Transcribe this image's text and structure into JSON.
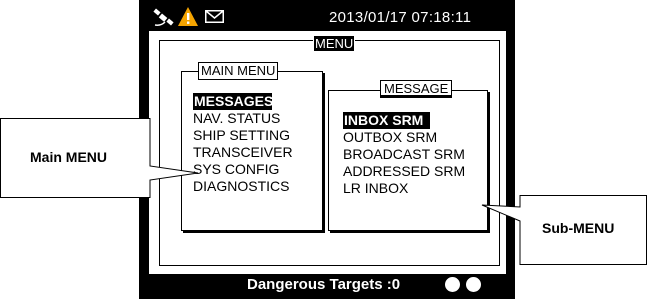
{
  "status_bar": {
    "datetime": "2013/01/17 07:18:11",
    "icons": [
      "satellite-icon",
      "warning-icon",
      "mail-icon"
    ]
  },
  "menu": {
    "title": "MENU",
    "main_menu": {
      "title": "MAIN MENU",
      "items": [
        {
          "label": "MESSAGES",
          "selected": true
        },
        {
          "label": "NAV. STATUS",
          "selected": false
        },
        {
          "label": "SHIP SETTING",
          "selected": false
        },
        {
          "label": "TRANSCEIVER",
          "selected": false
        },
        {
          "label": "SYS CONFIG",
          "selected": false
        },
        {
          "label": "DIAGNOSTICS",
          "selected": false
        }
      ]
    },
    "sub_menu": {
      "title": "MESSAGE",
      "items": [
        {
          "label": "INBOX SRM",
          "selected": true
        },
        {
          "label": "OUTBOX SRM",
          "selected": false
        },
        {
          "label": "BROADCAST SRM",
          "selected": false
        },
        {
          "label": "ADDRESSED SRM",
          "selected": false
        },
        {
          "label": "LR INBOX",
          "selected": false
        }
      ]
    }
  },
  "bottom_bar": {
    "text": "Dangerous Targets :0"
  },
  "callouts": {
    "main": "Main MENU",
    "sub": "Sub-MENU"
  },
  "colors": {
    "bezel": "#000000",
    "panel": "#ffffff",
    "warning": "#f5a400"
  }
}
